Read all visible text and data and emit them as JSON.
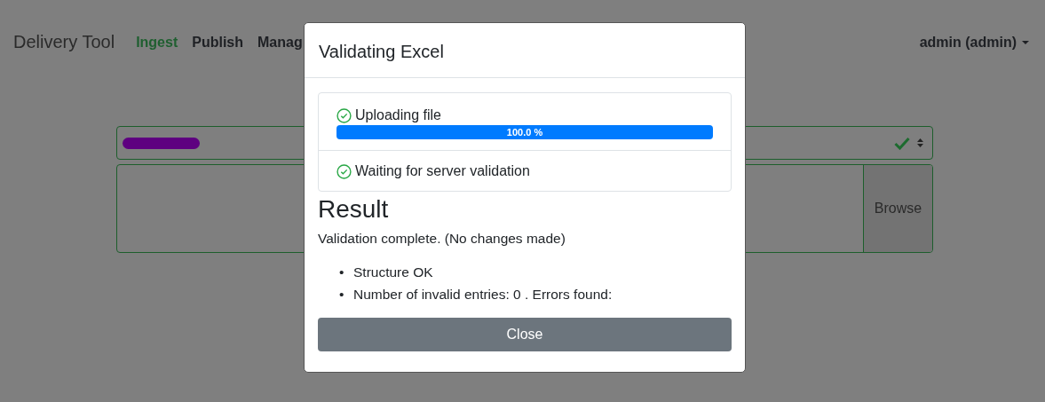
{
  "navbar": {
    "brand": "Delivery Tool",
    "links": [
      {
        "label": "Ingest",
        "selected": true
      },
      {
        "label": "Publish",
        "selected": false
      },
      {
        "label": "Manag",
        "selected": false
      }
    ],
    "user": "admin (admin)"
  },
  "form": {
    "select": {
      "valid": true
    },
    "file": {
      "valid": true,
      "button": "Browse"
    }
  },
  "modal": {
    "title": "Validating Excel",
    "steps": [
      {
        "label": "Uploading file",
        "done": true,
        "progress": {
          "level": 1,
          "text": "100.0 %"
        }
      },
      {
        "label": "Waiting for server validation",
        "done": true
      }
    ],
    "result_heading": "Result",
    "result_text": "Validation complete. (No changes made)",
    "result_items": [
      {
        "marker": "•",
        "text": "Structure OK"
      },
      {
        "marker": "•",
        "text": "Number of invalid entries: 0 . Errors found:"
      }
    ],
    "close_button": "Close"
  }
}
